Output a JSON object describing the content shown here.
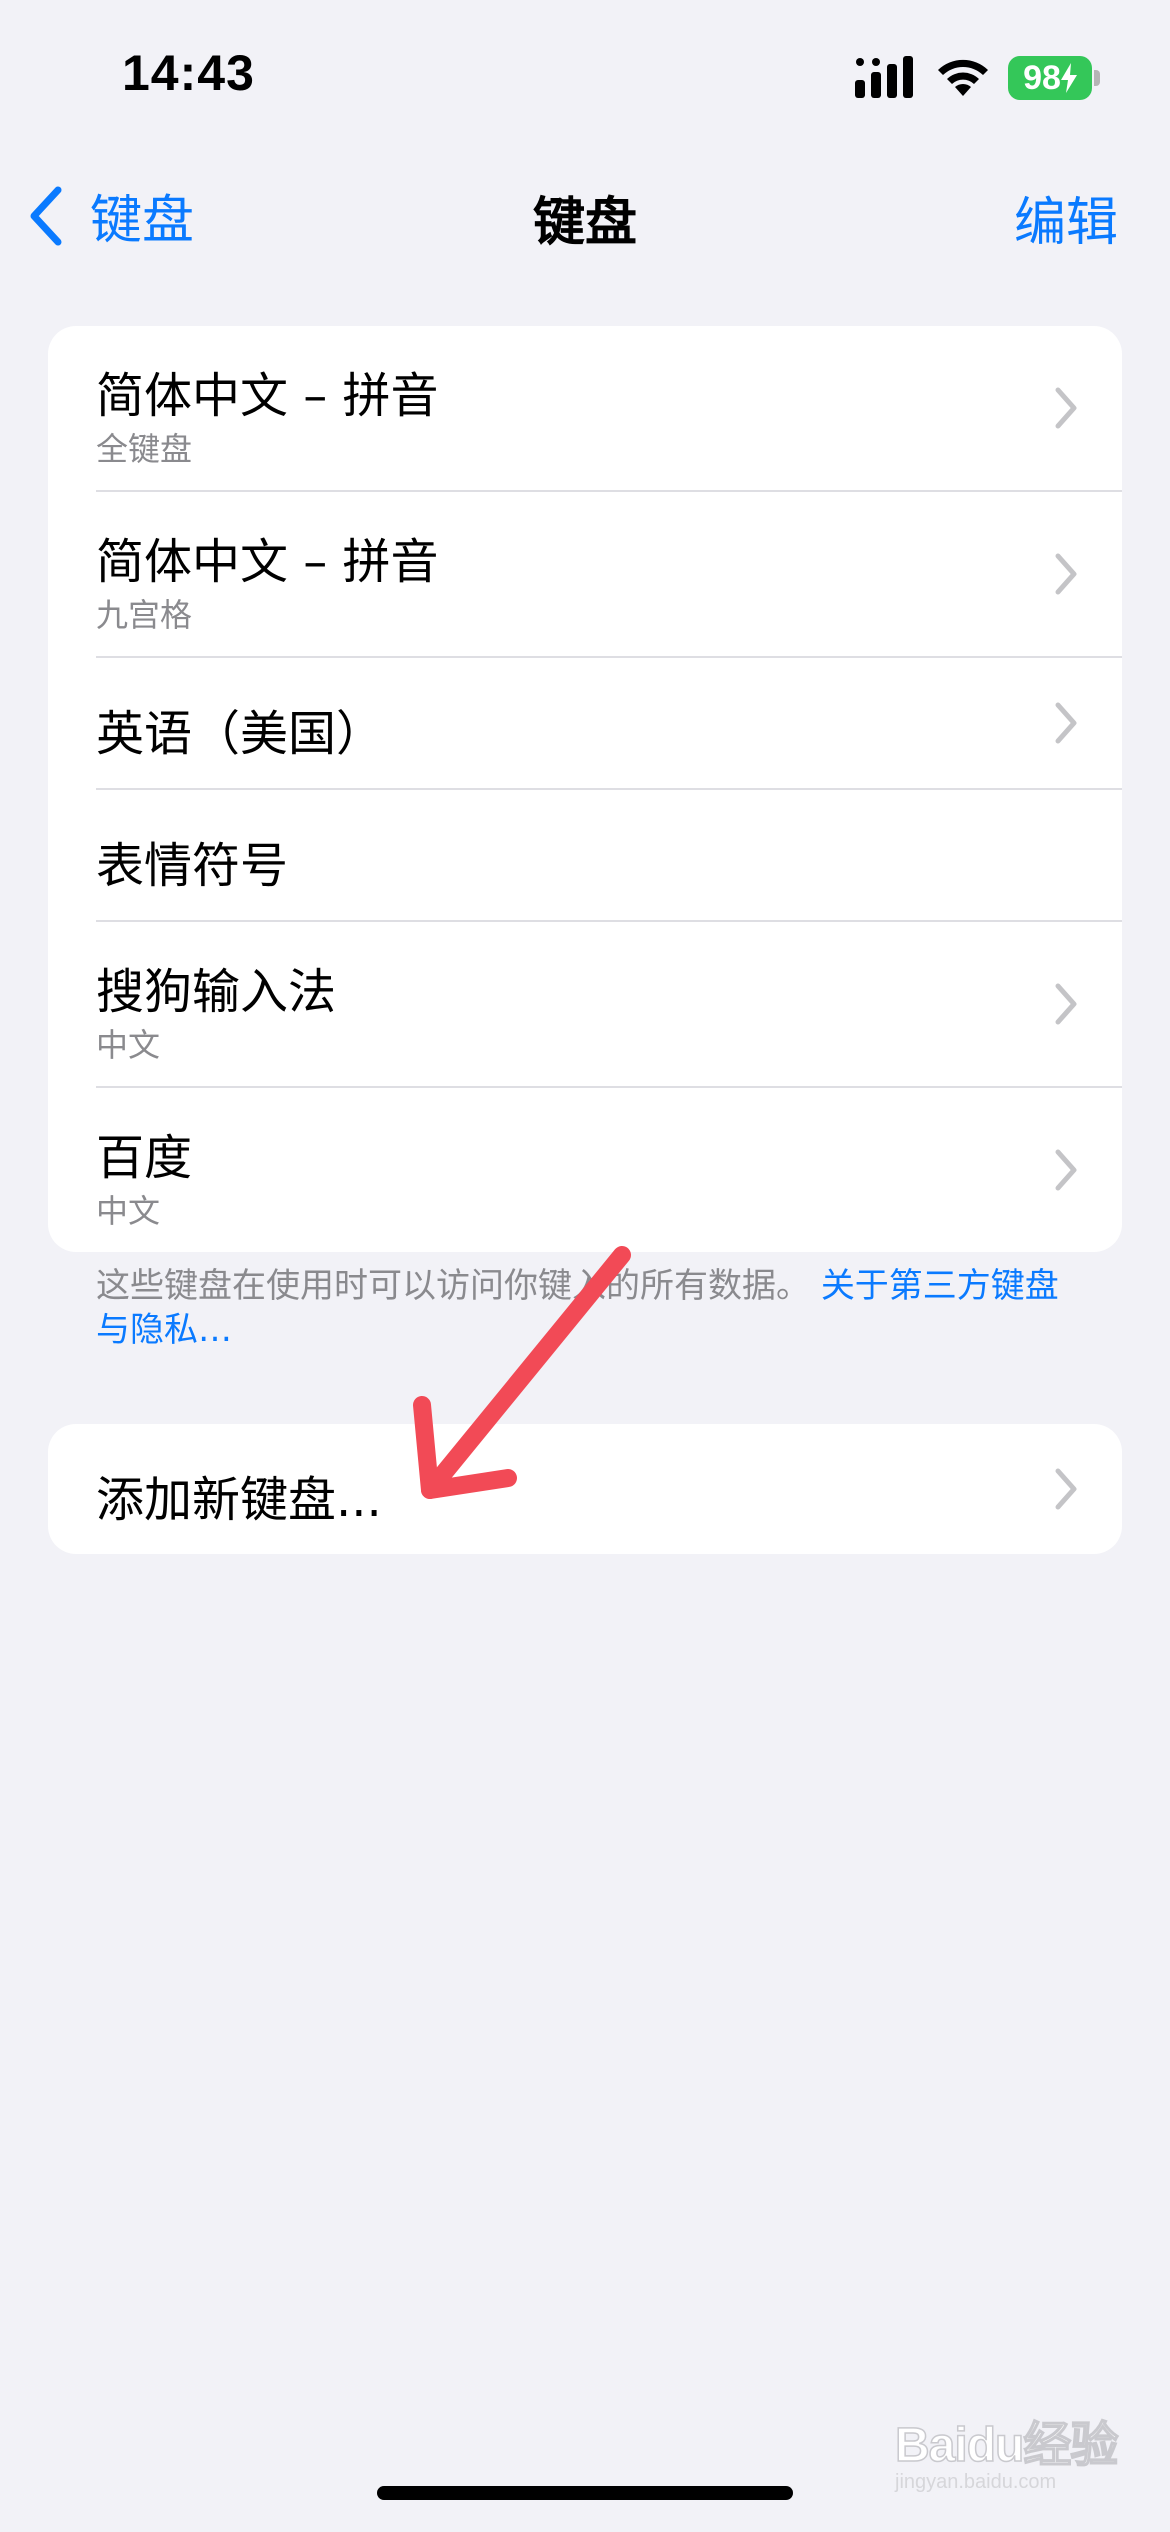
{
  "status_bar": {
    "time": "14:43",
    "battery_level": "98",
    "battery_color": "#34c759"
  },
  "nav": {
    "back_label": "键盘",
    "title": "键盘",
    "edit_label": "编辑"
  },
  "keyboards": [
    {
      "title": "简体中文 – 拼音",
      "subtitle": "全键盘",
      "has_chevron": true
    },
    {
      "title": "简体中文 – 拼音",
      "subtitle": "九宫格",
      "has_chevron": true
    },
    {
      "title": "英语（美国）",
      "subtitle": "",
      "has_chevron": true
    },
    {
      "title": "表情符号",
      "subtitle": "",
      "has_chevron": false
    },
    {
      "title": "搜狗输入法",
      "subtitle": "中文",
      "has_chevron": true
    },
    {
      "title": "百度",
      "subtitle": "中文",
      "has_chevron": true
    }
  ],
  "footer": {
    "note": "这些键盘在使用时可以访问你键入的所有数据。",
    "link": "关于第三方键盘与隐私…"
  },
  "add_keyboard": {
    "label": "添加新键盘..."
  },
  "watermark": {
    "brand": "Baidu经验",
    "url": "jingyan.baidu.com"
  },
  "colors": {
    "accent": "#0a7aff",
    "background": "#f2f2f7",
    "annotation_arrow": "#f24a56"
  }
}
